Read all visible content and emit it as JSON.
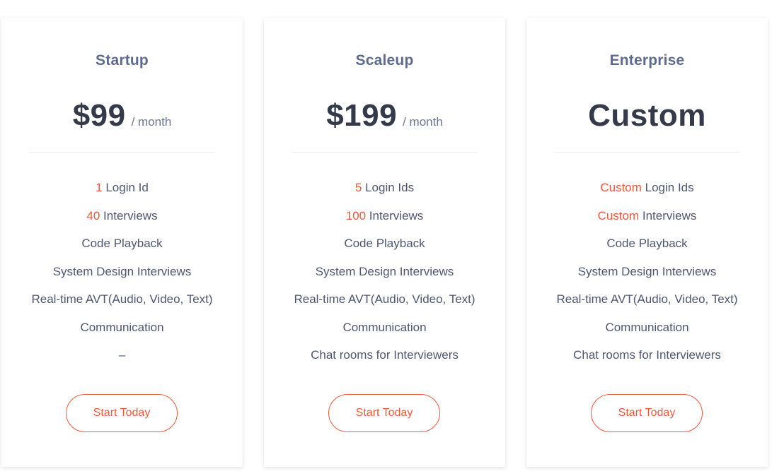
{
  "theme": {
    "accent": "#f0583a",
    "title_color": "#5d6b8f",
    "price_color": "#343a4a",
    "text_color": "#4f5670"
  },
  "plans": [
    {
      "name": "Startup",
      "price": "$99",
      "period": "/ month",
      "features": [
        {
          "highlight": "1",
          "text": " Login Id"
        },
        {
          "highlight": "40",
          "text": " Interviews"
        },
        {
          "highlight": "",
          "text": "Code Playback"
        },
        {
          "highlight": "",
          "text": "System Design Interviews"
        },
        {
          "highlight": "",
          "text": "Real-time AVT(Audio, Video, Text)"
        },
        {
          "highlight": "",
          "text": "Communication"
        },
        {
          "highlight": "",
          "text": "–"
        }
      ],
      "button": "Start Today"
    },
    {
      "name": "Scaleup",
      "price": "$199",
      "period": "/ month",
      "features": [
        {
          "highlight": "5",
          "text": " Login Ids"
        },
        {
          "highlight": "100",
          "text": " Interviews"
        },
        {
          "highlight": "",
          "text": "Code Playback"
        },
        {
          "highlight": "",
          "text": "System Design Interviews"
        },
        {
          "highlight": "",
          "text": "Real-time AVT(Audio, Video, Text)"
        },
        {
          "highlight": "",
          "text": "Communication"
        },
        {
          "highlight": "",
          "text": "Chat rooms for Interviewers"
        }
      ],
      "button": "Start Today"
    },
    {
      "name": "Enterprise",
      "price": "Custom",
      "period": "",
      "features": [
        {
          "highlight": "Custom",
          "text": " Login Ids"
        },
        {
          "highlight": "Custom",
          "text": " Interviews"
        },
        {
          "highlight": "",
          "text": "Code Playback"
        },
        {
          "highlight": "",
          "text": "System Design Interviews"
        },
        {
          "highlight": "",
          "text": "Real-time AVT(Audio, Video, Text)"
        },
        {
          "highlight": "",
          "text": "Communication"
        },
        {
          "highlight": "",
          "text": "Chat rooms for Interviewers"
        }
      ],
      "button": "Start Today"
    }
  ]
}
